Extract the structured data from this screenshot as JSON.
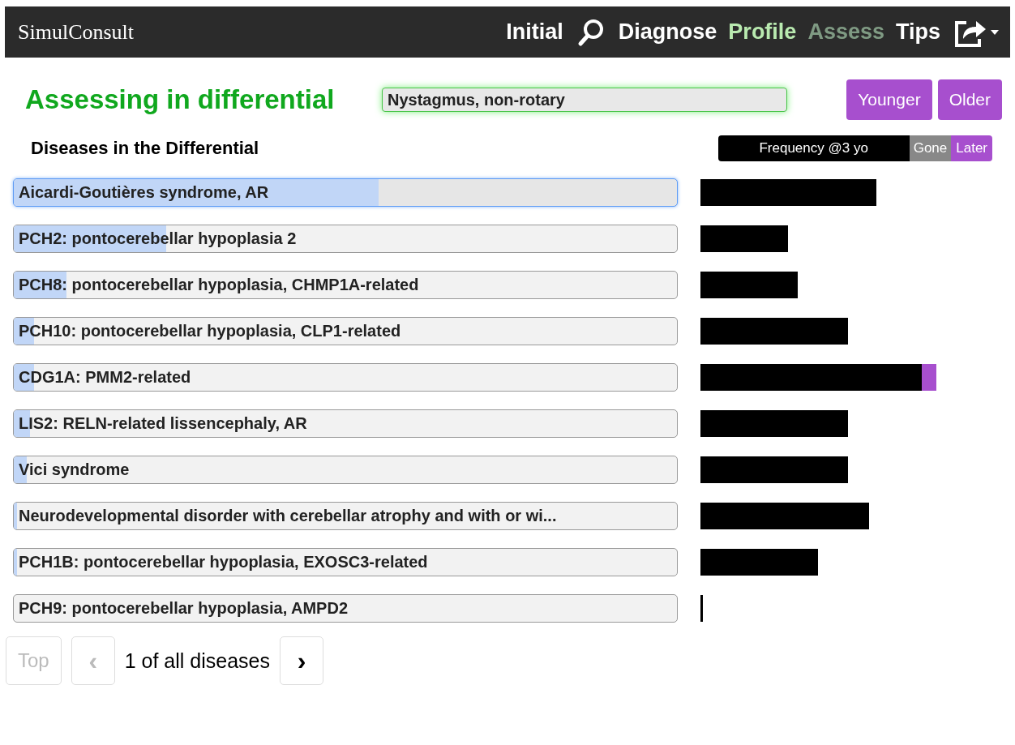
{
  "brand": "SimulConsult",
  "nav": [
    {
      "label": "Initial",
      "color": "#ffffff"
    },
    {
      "kind": "search"
    },
    {
      "label": "Diagnose",
      "color": "#ffffff"
    },
    {
      "label": "Profile",
      "color": "#b9eab0"
    },
    {
      "label": "Assess",
      "color": "#7f9a83"
    },
    {
      "label": "Tips",
      "color": "#ffffff"
    },
    {
      "kind": "share"
    }
  ],
  "title": "Assessing in differential",
  "finding": "Nystagmus, non-rotary",
  "age_buttons": [
    "Younger",
    "Older"
  ],
  "list_heading": "Diseases in the Differential",
  "legend": {
    "frequency": "Frequency @3 yo",
    "gone": "Gone",
    "later": "Later"
  },
  "diseases": [
    {
      "name": "Aicardi-Goutières syndrome, AR",
      "selected": true,
      "level": 0.55
    },
    {
      "name": "PCH2: pontocerebellar hypoplasia 2",
      "selected": false,
      "level": 0.23
    },
    {
      "name": "PCH8: pontocerebellar hypoplasia, CHMP1A-related",
      "selected": false,
      "level": 0.08
    },
    {
      "name": "PCH10: pontocerebellar hypoplasia, CLP1-related",
      "selected": false,
      "level": 0.03
    },
    {
      "name": "CDG1A: PMM2-related",
      "selected": false,
      "level": 0.03
    },
    {
      "name": "LIS2: RELN-related lissencephaly, AR",
      "selected": false,
      "level": 0.025
    },
    {
      "name": "Vici syndrome",
      "selected": false,
      "level": 0.02
    },
    {
      "name": "Neurodevelopmental disorder with cerebellar atrophy and with or wi...",
      "selected": false,
      "level": 0.005
    },
    {
      "name": "PCH1B: pontocerebellar hypoplasia, EXOSC3-related",
      "selected": false,
      "level": 0.005
    },
    {
      "name": "PCH9: pontocerebellar hypoplasia, AMPD2",
      "selected": false
    }
  ],
  "pager": {
    "top": {
      "label": "Top",
      "disabled": true
    },
    "prev": {
      "label": "‹",
      "disabled": true
    },
    "status": "1 of all diseases",
    "next": {
      "label": "›",
      "disabled": false
    }
  }
}
